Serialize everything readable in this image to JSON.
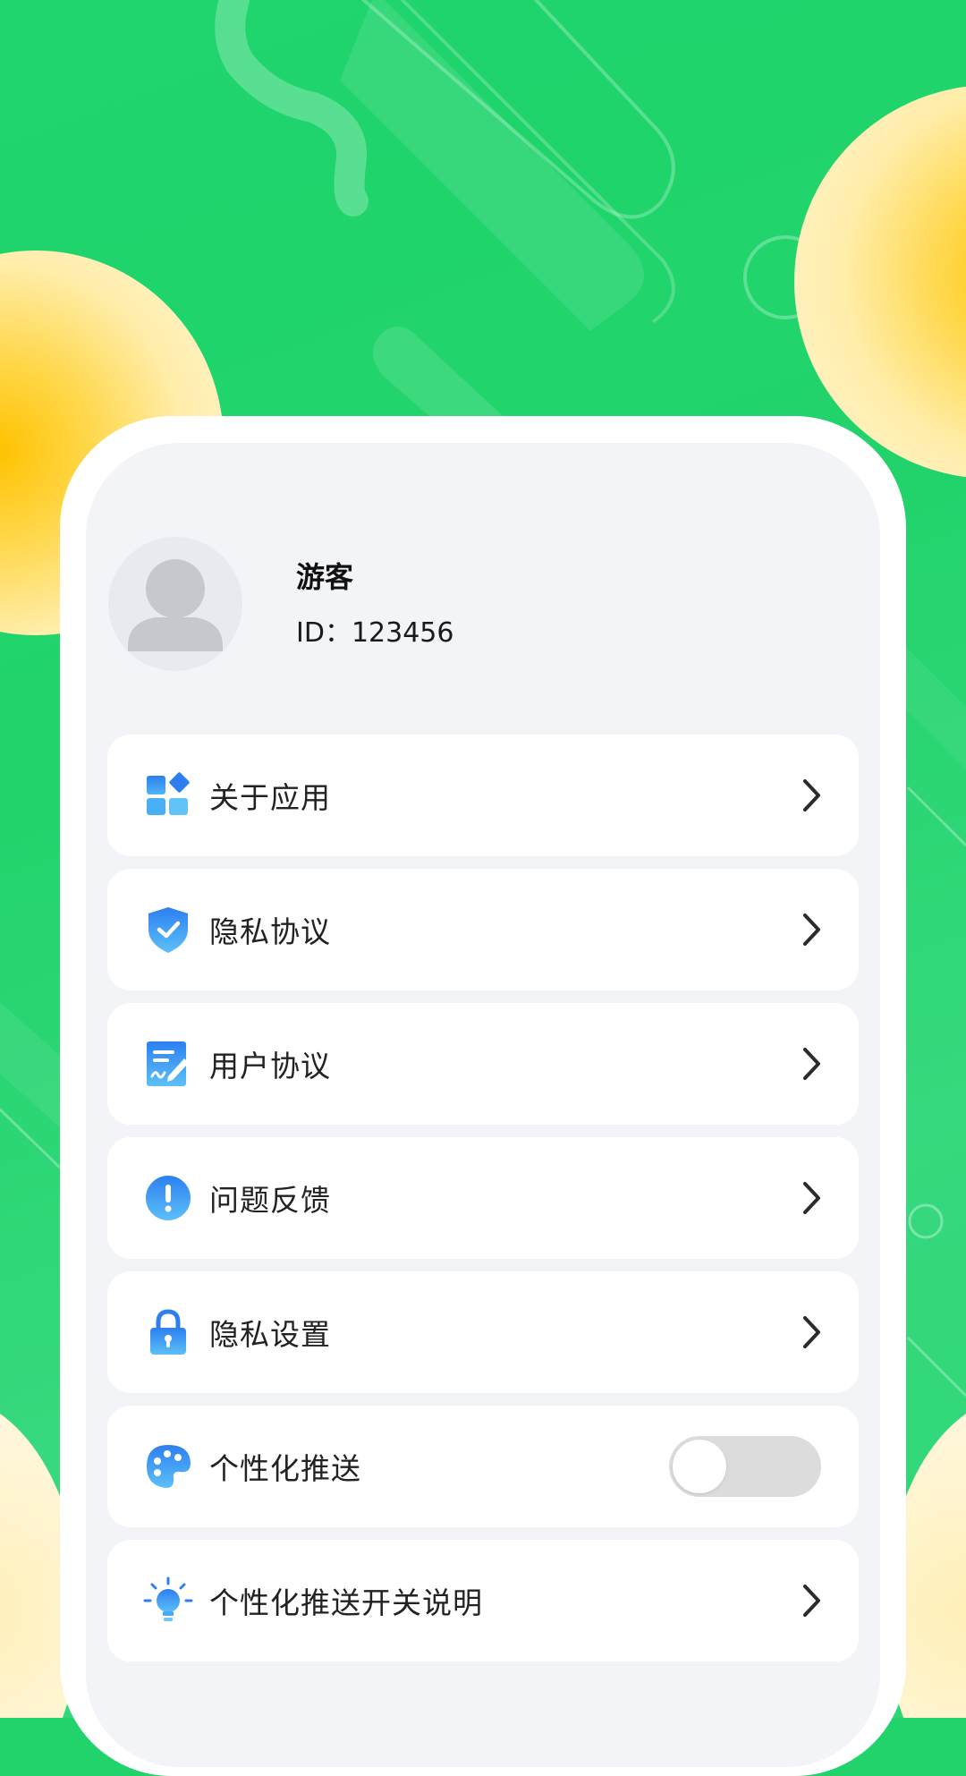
{
  "profile": {
    "name": "游客",
    "id_text": "ID：123456",
    "avatar_icon": "default-user-icon"
  },
  "menu": [
    {
      "label": "关于应用",
      "icon": "apps-icon",
      "control": "chevron"
    },
    {
      "label": "隐私协议",
      "icon": "shield-check-icon",
      "control": "chevron"
    },
    {
      "label": "用户协议",
      "icon": "document-sign-icon",
      "control": "chevron"
    },
    {
      "label": "问题反馈",
      "icon": "exclamation-icon",
      "control": "chevron"
    },
    {
      "label": "隐私设置",
      "icon": "lock-icon",
      "control": "chevron"
    },
    {
      "label": "个性化推送",
      "icon": "palette-icon",
      "control": "toggle",
      "toggle_on": false
    },
    {
      "label": "个性化推送开关说明",
      "icon": "lightbulb-icon",
      "control": "chevron"
    }
  ],
  "colors": {
    "background": "#22d36c",
    "accent_blue": "#2d8cf0",
    "toggle_off": "#dcdcdc",
    "card": "#ffffff",
    "screen": "#f2f4f8"
  }
}
